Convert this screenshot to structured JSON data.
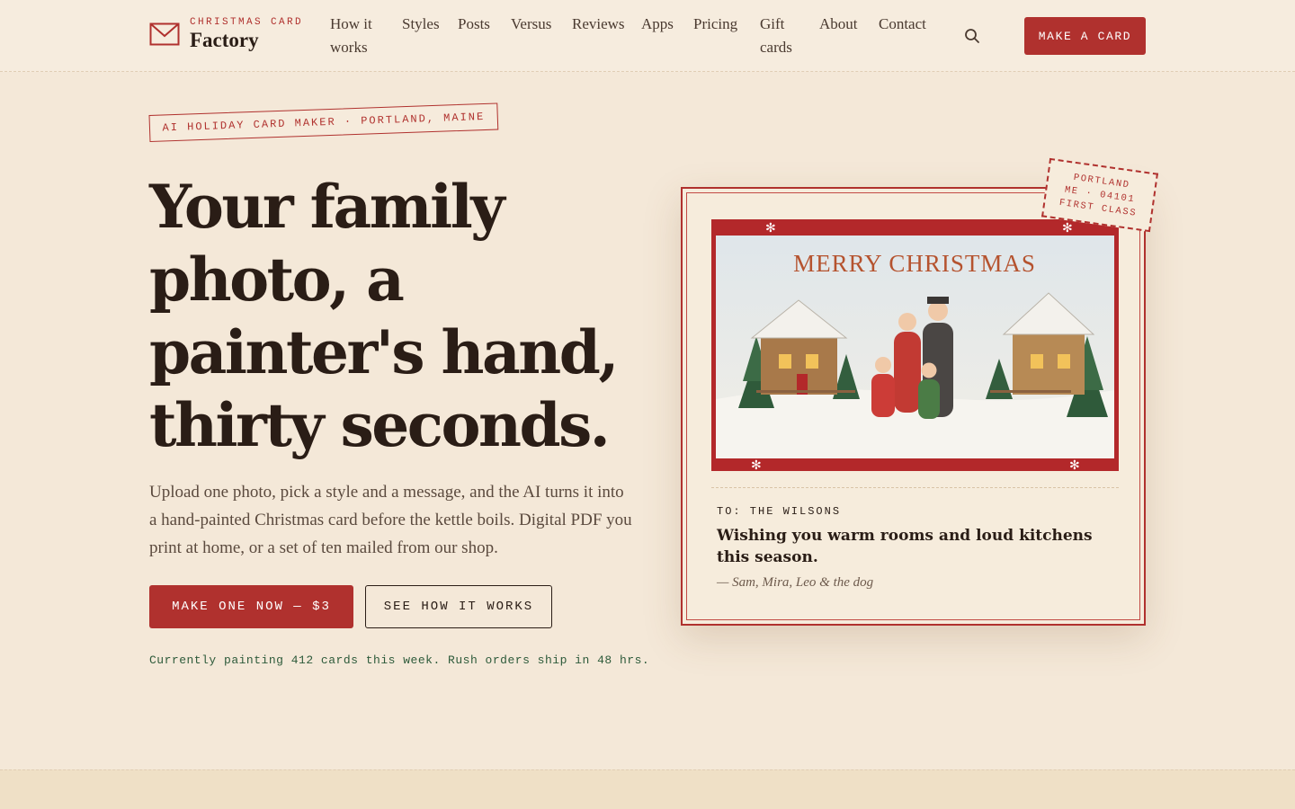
{
  "brand": {
    "small": "CHRISTMAS CARD",
    "name": "Factory"
  },
  "nav": [
    {
      "label": "How it works"
    },
    {
      "label": "Styles"
    },
    {
      "label": "Posts"
    },
    {
      "label": "Versus"
    },
    {
      "label": "Reviews"
    },
    {
      "label": "Apps"
    },
    {
      "label": "Pricing"
    },
    {
      "label": "Gift cards"
    },
    {
      "label": "About"
    },
    {
      "label": "Contact"
    }
  ],
  "header_cta": "MAKE A CARD",
  "hero": {
    "tag": "AI HOLIDAY CARD MAKER · PORTLAND, MAINE",
    "headline": "Your family photo, a painter's hand, thirty seconds.",
    "subtext": "Upload one photo, pick a style and a message, and the AI turns it into a hand-painted Christmas card before the kettle boils. Digital PDF you print at home, or a set of ten mailed from our shop.",
    "primary_button": "MAKE ONE NOW — $3",
    "secondary_button": "SEE HOW IT WORKS",
    "status": "Currently painting 412 cards this week. Rush orders ship in 48 hrs."
  },
  "card": {
    "illustration_text": "MERRY CHRISTMAS",
    "to": "TO: THE WILSONS",
    "message": "Wishing you warm rooms and loud kitchens this season.",
    "signature": "— Sam, Mira, Leo & the dog"
  },
  "stamp": {
    "line1": "PORTLAND",
    "line2": "ME · 04101",
    "line3": "FIRST CLASS"
  },
  "colors": {
    "accent": "#b0312e",
    "background": "#f4e8d8",
    "text": "#2a1d16",
    "status": "#2d5a3a"
  }
}
